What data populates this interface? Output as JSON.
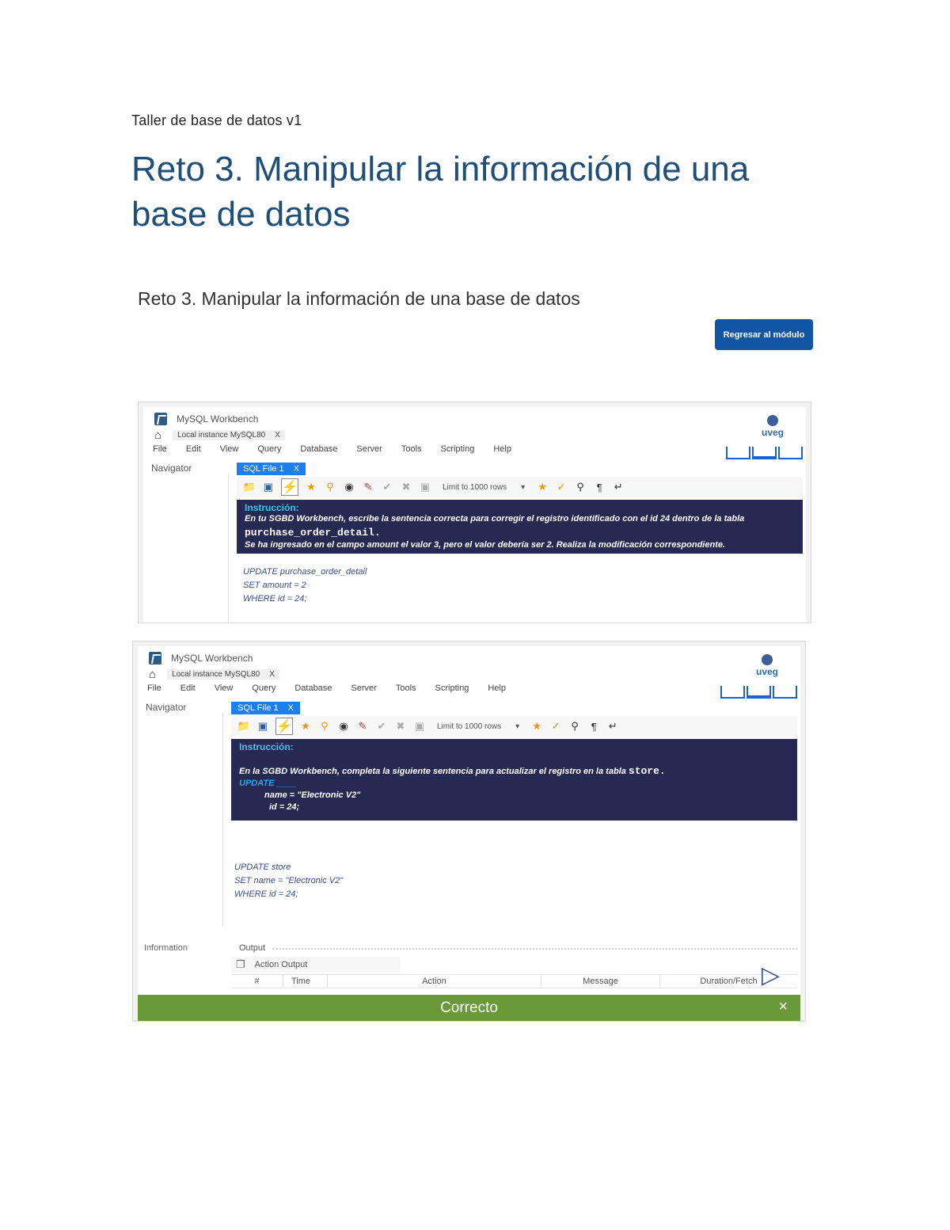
{
  "doc": {
    "header": "Taller de base de datos v1",
    "title": "Reto 3. Manipular la información de una base de datos"
  },
  "module": {
    "title": "Reto 3. Manipular la información de una base de datos",
    "back_button": "Regresar al módulo"
  },
  "workbench": {
    "app_title": "MySQL Workbench",
    "instance_tab": "Local instance MySQL80",
    "close": "X",
    "menu": [
      "File",
      "Edit",
      "View",
      "Query",
      "Database",
      "Server",
      "Tools",
      "Scripting",
      "Help"
    ],
    "navigator": "Navigator",
    "sql_tab": "SQL File 1",
    "limit": "Limit to 1000 rows",
    "logo": "uveg"
  },
  "screen1": {
    "instruction_head": "Instrucción:",
    "line1": "En tu SGBD Workbench, escribe la sentencia correcta para corregir el registro identificado con el id 24 dentro de la tabla",
    "table": "purchase_order_detail.",
    "line3": "Se ha ingresado en el campo amount el valor 3, pero el valor debería ser 2. Realiza la modificación correspondiente.",
    "code": [
      "UPDATE purchase_order_detail",
      "SET amount = 2",
      "WHERE id = 24;"
    ]
  },
  "screen2": {
    "instruction_head": "Instrucción:",
    "line1": "En la SGBD Workbench, completa la siguiente sentencia para actualizar el registro en la tabla",
    "table": "store.",
    "template": [
      "UPDATE ____",
      "name = \"Electronic V2\"",
      "id = 24;"
    ],
    "code": [
      "UPDATE store",
      "SET name = \"Electronic V2\"",
      "WHERE id = 24;"
    ],
    "information": "Information",
    "output": "Output",
    "action_output": "Action Output",
    "columns": [
      "#",
      "Time",
      "Action",
      "Message",
      "Duration/Fetch"
    ],
    "status": "Correcto",
    "status_close": "×"
  }
}
